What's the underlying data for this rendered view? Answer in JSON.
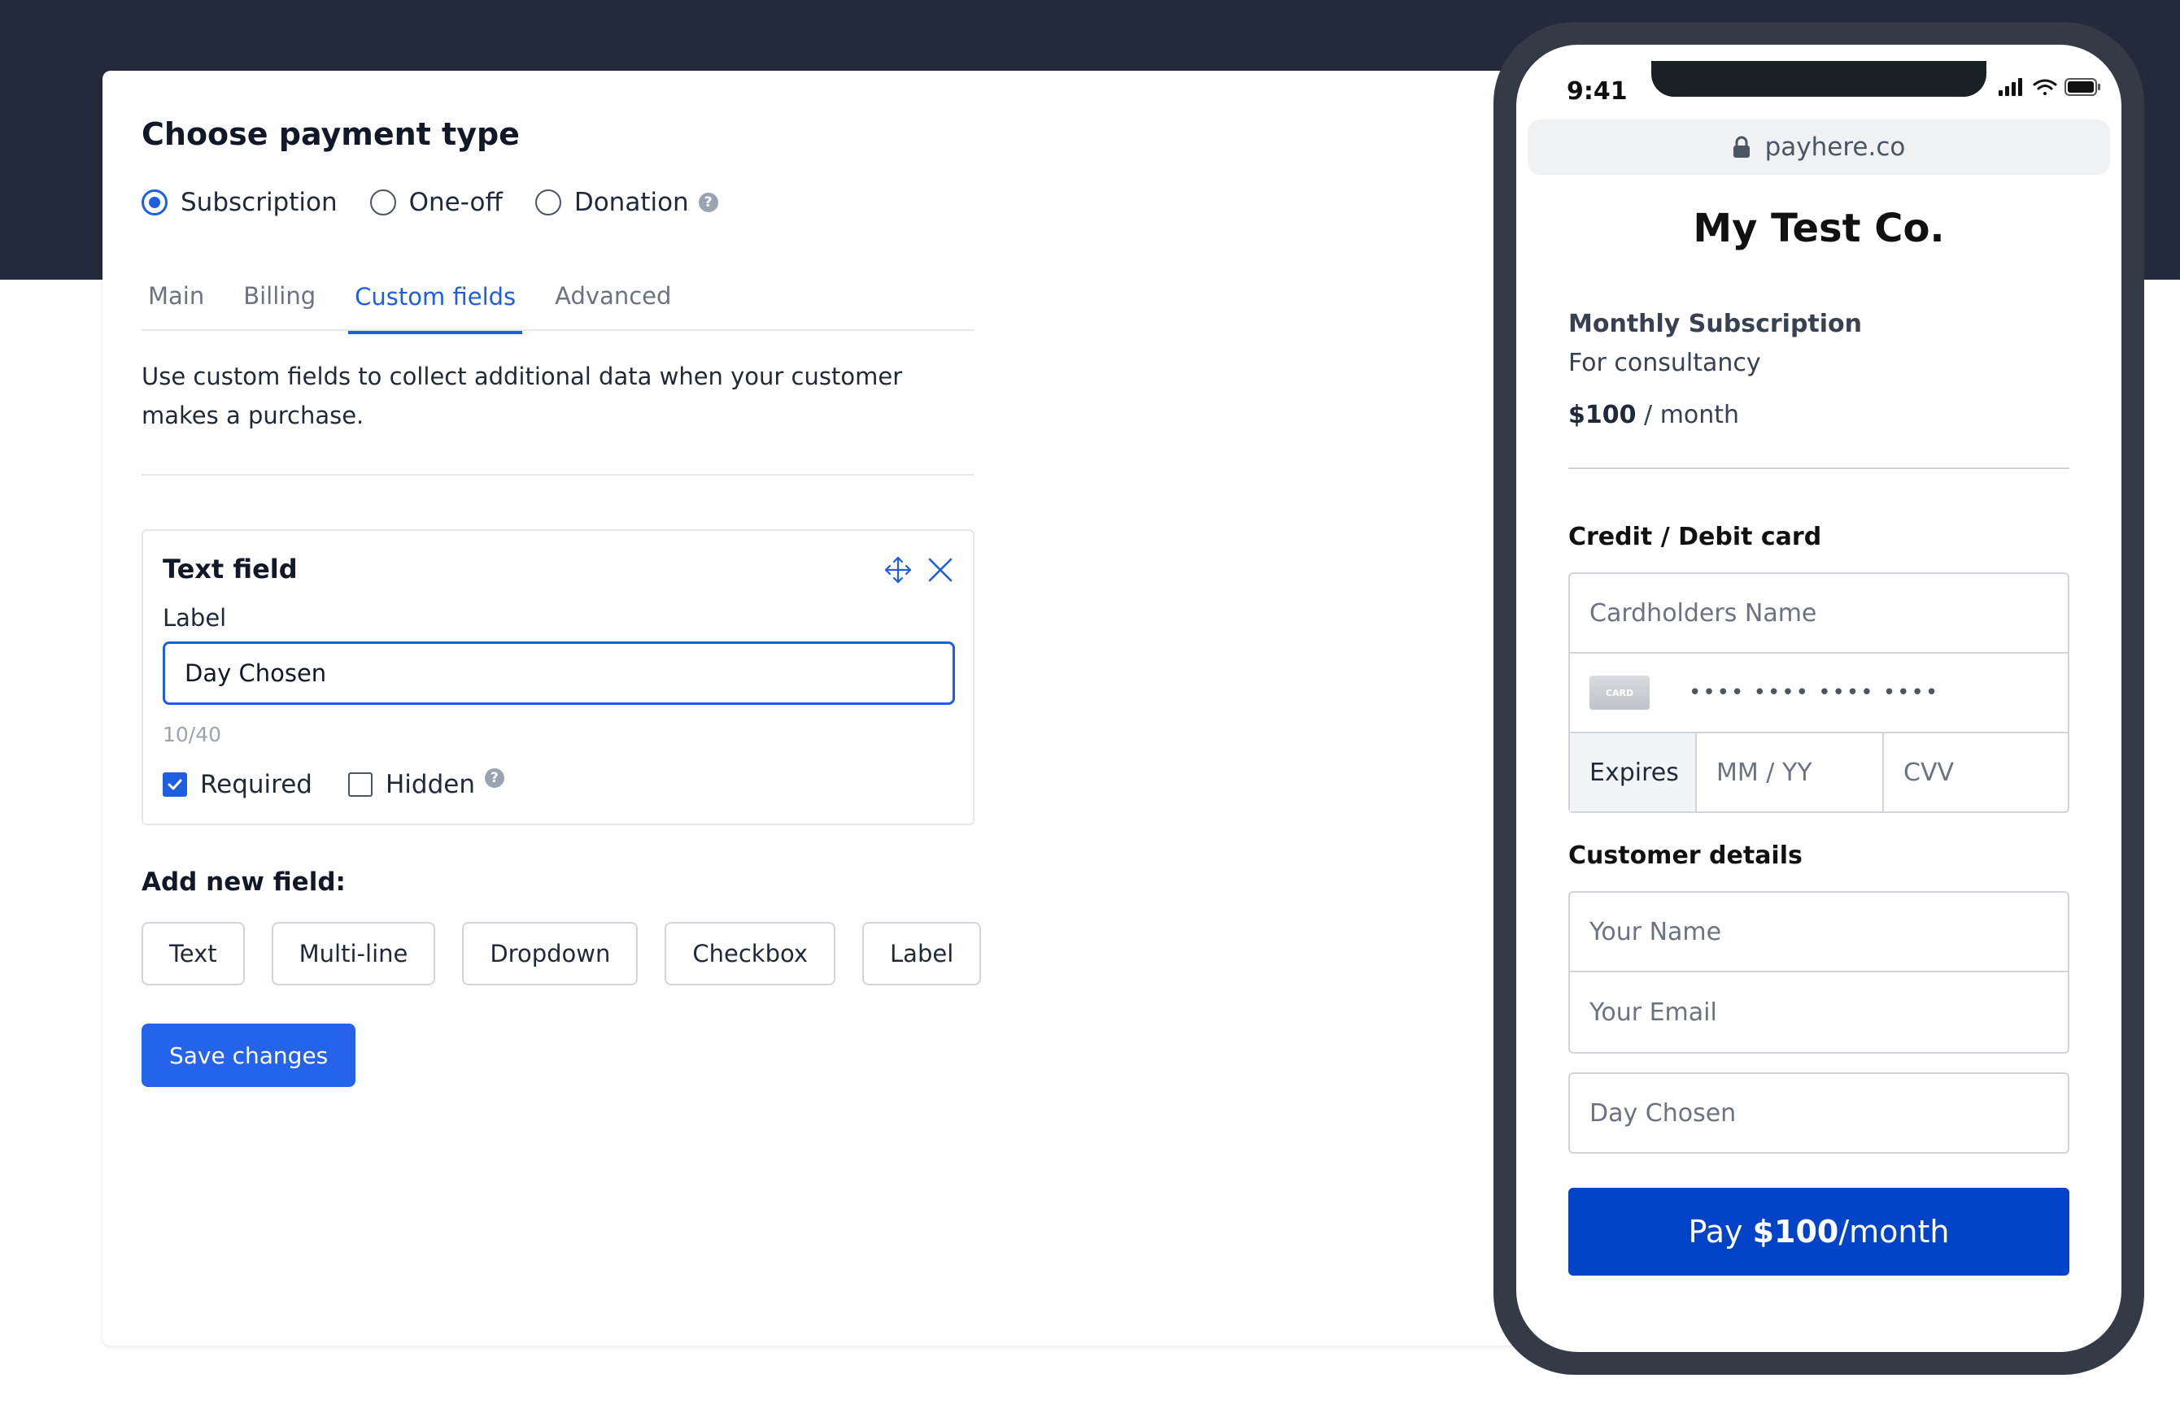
{
  "editor": {
    "title": "Choose payment type",
    "payment_types": [
      {
        "label": "Subscription",
        "selected": true
      },
      {
        "label": "One-off",
        "selected": false
      },
      {
        "label": "Donation",
        "selected": false
      }
    ],
    "help_glyph": "?",
    "tabs": [
      {
        "label": "Main",
        "active": false
      },
      {
        "label": "Billing",
        "active": false
      },
      {
        "label": "Custom fields",
        "active": true
      },
      {
        "label": "Advanced",
        "active": false
      }
    ],
    "intro": "Use custom fields to collect additional data when your customer makes a purchase.",
    "field": {
      "title": "Text field",
      "label_caption": "Label",
      "label_value": "Day Chosen",
      "char_count": "10/40",
      "required_label": "Required",
      "required_checked": true,
      "hidden_label": "Hidden",
      "hidden_checked": false
    },
    "add_title": "Add new field:",
    "add_buttons": [
      "Text",
      "Multi-line",
      "Dropdown",
      "Checkbox",
      "Label"
    ],
    "save_label": "Save changes",
    "accent_color": "#1d5fe0"
  },
  "preview": {
    "time": "9:41",
    "url": "payhere.co",
    "shop_name": "My Test Co.",
    "product_name": "Monthly Subscription",
    "product_desc": "For consultancy",
    "price_amount": "$100",
    "price_period": "/ month",
    "card_section": "Credit / Debit card",
    "cardholder_placeholder": "Cardholders Name",
    "card_icon_text": "CARD",
    "card_number_placeholder": "•••• •••• •••• ••••",
    "expires_label": "Expires",
    "expiry_placeholder": "MM / YY",
    "cvv_placeholder": "CVV",
    "customer_section": "Customer details",
    "name_placeholder": "Your Name",
    "email_placeholder": "Your Email",
    "custom_field_placeholder": "Day Chosen",
    "pay_prefix": "Pay ",
    "pay_amount": "$100",
    "pay_suffix": "/month",
    "pay_color": "#0343c7"
  }
}
